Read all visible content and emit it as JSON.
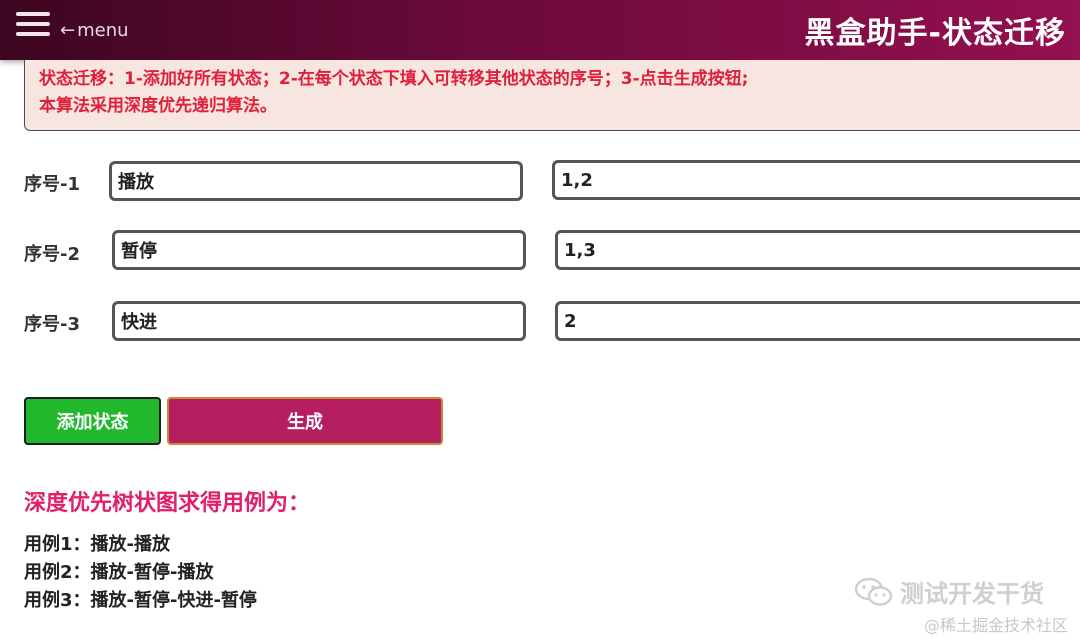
{
  "header": {
    "menu_label": "menu",
    "title": "黑盒助手-状态迁移"
  },
  "notice": {
    "line1": "状态迁移：1-添加好所有状态；2-在每个状态下填入可转移其他状态的序号；3-点击生成按钮;",
    "line2": "本算法采用深度优先递归算法。"
  },
  "states": [
    {
      "label": "序号-1",
      "name": "播放",
      "transitions": "1,2"
    },
    {
      "label": "序号-2",
      "name": "暂停",
      "transitions": "1,3"
    },
    {
      "label": "序号-3",
      "name": "快进",
      "transitions": "2"
    }
  ],
  "buttons": {
    "add_label": "添加状态",
    "generate_label": "生成"
  },
  "result": {
    "heading": "深度优先树状图求得用例为：",
    "cases": [
      "用例1：播放-播放",
      "用例2：播放-暂停-播放",
      "用例3：播放-暂停-快进-暂停"
    ]
  },
  "watermark": {
    "main": "测试开发干货",
    "sub": "@稀土掘金技术社区"
  }
}
